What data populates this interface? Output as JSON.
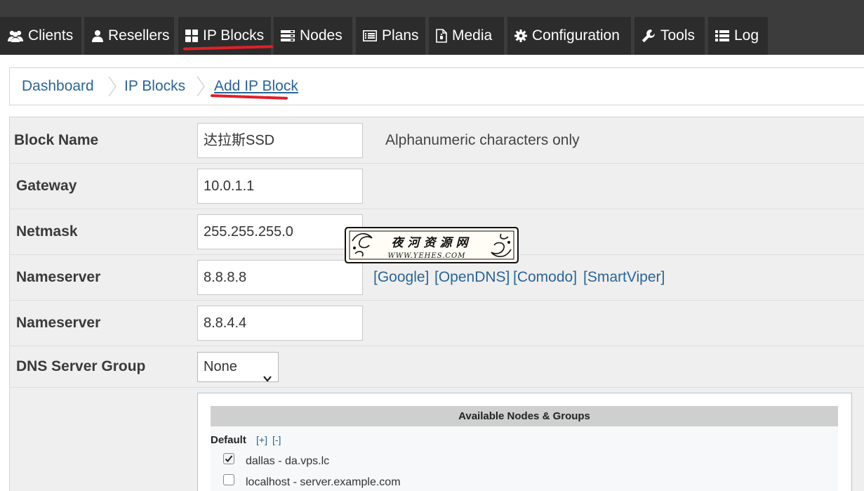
{
  "nav": {
    "tabs": [
      {
        "label": "Clients",
        "icon": "users-icon"
      },
      {
        "label": "Resellers",
        "icon": "user-icon"
      },
      {
        "label": "IP Blocks",
        "icon": "grid-icon",
        "active": true
      },
      {
        "label": "Nodes",
        "icon": "server-icon"
      },
      {
        "label": "Plans",
        "icon": "list-alt-icon"
      },
      {
        "label": "Media",
        "icon": "file-icon"
      },
      {
        "label": "Configuration",
        "icon": "gear-icon"
      },
      {
        "label": "Tools",
        "icon": "wrench-icon"
      },
      {
        "label": "Log",
        "icon": "list-icon"
      }
    ]
  },
  "breadcrumb": [
    "Dashboard",
    "IP Blocks",
    "Add IP Block"
  ],
  "form": {
    "block_name": {
      "label": "Block Name",
      "value": "达拉斯SSD",
      "hint": "Alphanumeric characters only"
    },
    "gateway": {
      "label": "Gateway",
      "value": "10.0.1.1"
    },
    "netmask": {
      "label": "Netmask",
      "value": "255.255.255.0"
    },
    "nameserver1": {
      "label": "Nameserver",
      "value": "8.8.8.8"
    },
    "dns_links": [
      "[Google]",
      "[OpenDNS]",
      "[Comodo]",
      "[SmartViper]"
    ],
    "nameserver2": {
      "label": "Nameserver",
      "value": "8.8.4.4"
    },
    "dns_group": {
      "label": "DNS Server Group",
      "value": "None"
    }
  },
  "nodes": {
    "heading": "Available Nodes & Groups",
    "group": {
      "name": "Default",
      "expand": "[+]",
      "collapse": "[-]"
    },
    "items": [
      {
        "label": "dallas - da.vps.lc",
        "checked": true
      },
      {
        "label": "localhost - server.example.com",
        "checked": false
      }
    ]
  },
  "watermark": {
    "title": "夜河资源网",
    "url": "WWW.YEHES.COM"
  },
  "colors": {
    "nav_bg": "#3c3c3c",
    "tab_bg": "#2c2c2c",
    "link": "#2a6496",
    "annotation": "#e0202a"
  }
}
